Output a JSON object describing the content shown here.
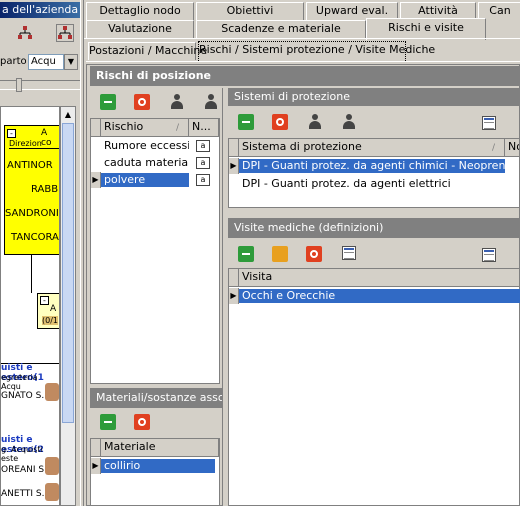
{
  "left": {
    "title": "a dell'azienda",
    "reparto_label": "parto",
    "reparto_value": "Acqu",
    "org_boxes": [
      "A co",
      "Direzion",
      "ANTINOR",
      "RABB",
      "SANDRONI",
      "TANCORA"
    ],
    "node1_a": "A",
    "node1_b": "(0/1",
    "unit1": "uisti e estero(1",
    "unit1_sub": "egreteria Acqu",
    "person1": "GNATO S.",
    "unit2": "uisti e estero(2",
    "unit2_sub": "g. Acquisti este",
    "person2": "OREANI S.",
    "person3": "ANETTI S."
  },
  "tabs_row1": [
    "Dettaglio nodo",
    "Obiettivi",
    "Upward eval.",
    "Attività",
    "Can"
  ],
  "tabs_row2": [
    "Valutazione",
    "Scadenze e materiale",
    "Rischi e visite"
  ],
  "subtabs": [
    "Postazioni / Macchine",
    "Rischi / Sistemi protezione / Visite Mediche"
  ],
  "main": {
    "title": "Rischi di posizione",
    "risks": {
      "col_rischio": "Rischio",
      "col_n": "N...",
      "rows": [
        {
          "label": "Rumore eccessivo",
          "badge": "a"
        },
        {
          "label": "caduta materiale",
          "badge": "a"
        },
        {
          "label": "polvere",
          "badge": "a"
        }
      ]
    },
    "protection": {
      "title": "Sistemi di protezione",
      "col_sistema": "Sistema di protezione",
      "col_no": "No",
      "rows": [
        "DPI - Guanti protez. da agenti chimici - Neoprene",
        "DPI - Guanti protez. da agenti elettrici"
      ]
    },
    "visits": {
      "title": "Visite mediche (definizioni)",
      "col_visita": "Visita",
      "rows": [
        "Occhi e Orecchie"
      ]
    },
    "materials": {
      "title": "Materiali/sostanze associa",
      "col_materiale": "Materiale",
      "rows": [
        "collirio"
      ]
    }
  },
  "icons": {
    "add": "green-arrow-icon",
    "remove": "red-circle-icon",
    "person": "person-icon",
    "grid": "grid-icon"
  }
}
